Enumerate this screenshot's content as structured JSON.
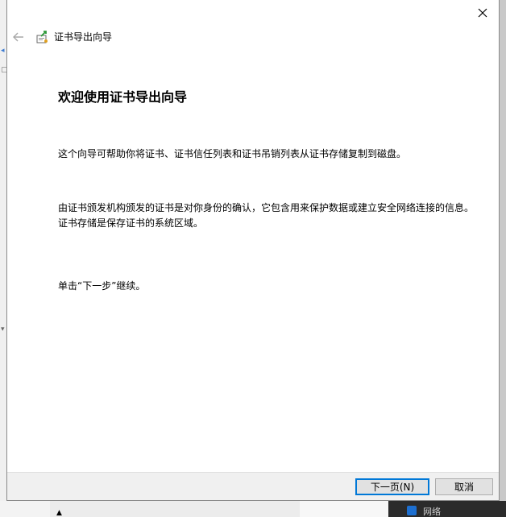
{
  "wizard": {
    "title": "证书导出向导",
    "heading": "欢迎使用证书导出向导",
    "paragraphs": [
      "这个向导可帮助你将证书、证书信任列表和证书吊销列表从证书存储复制到磁盘。",
      "由证书颁发机构颁发的证书是对你身份的确认，它包含用来保护数据或建立安全网络连接的信息。证书存储是保存证书的系统区域。",
      "单击“下一步”继续。"
    ]
  },
  "footer": {
    "next_label": "下一页(N)",
    "cancel_label": "取消"
  },
  "background": {
    "taskbar_fragment": "网络"
  },
  "icons": {
    "back": "back-arrow-icon",
    "close": "close-icon",
    "wizard": "certificate-icon"
  },
  "colors": {
    "accent": "#0078d7",
    "footer_bg": "#f0f0f0",
    "dialog_bg": "#ffffff"
  }
}
